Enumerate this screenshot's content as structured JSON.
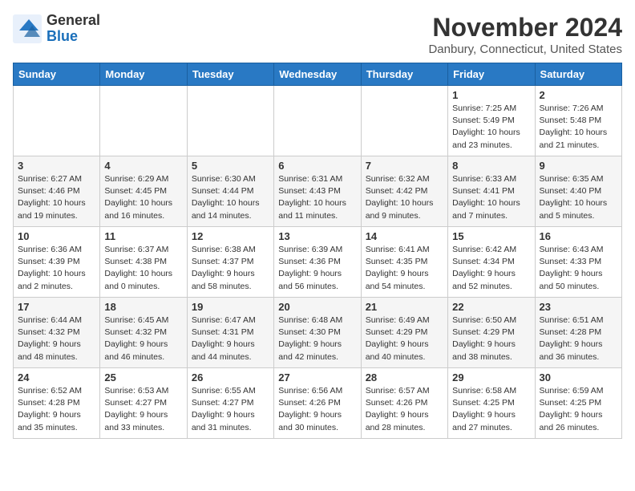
{
  "header": {
    "logo_general": "General",
    "logo_blue": "Blue",
    "month": "November 2024",
    "location": "Danbury, Connecticut, United States"
  },
  "columns": [
    "Sunday",
    "Monday",
    "Tuesday",
    "Wednesday",
    "Thursday",
    "Friday",
    "Saturday"
  ],
  "weeks": [
    [
      {
        "day": "",
        "info": ""
      },
      {
        "day": "",
        "info": ""
      },
      {
        "day": "",
        "info": ""
      },
      {
        "day": "",
        "info": ""
      },
      {
        "day": "",
        "info": ""
      },
      {
        "day": "1",
        "info": "Sunrise: 7:25 AM\nSunset: 5:49 PM\nDaylight: 10 hours\nand 23 minutes."
      },
      {
        "day": "2",
        "info": "Sunrise: 7:26 AM\nSunset: 5:48 PM\nDaylight: 10 hours\nand 21 minutes."
      }
    ],
    [
      {
        "day": "3",
        "info": "Sunrise: 6:27 AM\nSunset: 4:46 PM\nDaylight: 10 hours\nand 19 minutes."
      },
      {
        "day": "4",
        "info": "Sunrise: 6:29 AM\nSunset: 4:45 PM\nDaylight: 10 hours\nand 16 minutes."
      },
      {
        "day": "5",
        "info": "Sunrise: 6:30 AM\nSunset: 4:44 PM\nDaylight: 10 hours\nand 14 minutes."
      },
      {
        "day": "6",
        "info": "Sunrise: 6:31 AM\nSunset: 4:43 PM\nDaylight: 10 hours\nand 11 minutes."
      },
      {
        "day": "7",
        "info": "Sunrise: 6:32 AM\nSunset: 4:42 PM\nDaylight: 10 hours\nand 9 minutes."
      },
      {
        "day": "8",
        "info": "Sunrise: 6:33 AM\nSunset: 4:41 PM\nDaylight: 10 hours\nand 7 minutes."
      },
      {
        "day": "9",
        "info": "Sunrise: 6:35 AM\nSunset: 4:40 PM\nDaylight: 10 hours\nand 5 minutes."
      }
    ],
    [
      {
        "day": "10",
        "info": "Sunrise: 6:36 AM\nSunset: 4:39 PM\nDaylight: 10 hours\nand 2 minutes."
      },
      {
        "day": "11",
        "info": "Sunrise: 6:37 AM\nSunset: 4:38 PM\nDaylight: 10 hours\nand 0 minutes."
      },
      {
        "day": "12",
        "info": "Sunrise: 6:38 AM\nSunset: 4:37 PM\nDaylight: 9 hours\nand 58 minutes."
      },
      {
        "day": "13",
        "info": "Sunrise: 6:39 AM\nSunset: 4:36 PM\nDaylight: 9 hours\nand 56 minutes."
      },
      {
        "day": "14",
        "info": "Sunrise: 6:41 AM\nSunset: 4:35 PM\nDaylight: 9 hours\nand 54 minutes."
      },
      {
        "day": "15",
        "info": "Sunrise: 6:42 AM\nSunset: 4:34 PM\nDaylight: 9 hours\nand 52 minutes."
      },
      {
        "day": "16",
        "info": "Sunrise: 6:43 AM\nSunset: 4:33 PM\nDaylight: 9 hours\nand 50 minutes."
      }
    ],
    [
      {
        "day": "17",
        "info": "Sunrise: 6:44 AM\nSunset: 4:32 PM\nDaylight: 9 hours\nand 48 minutes."
      },
      {
        "day": "18",
        "info": "Sunrise: 6:45 AM\nSunset: 4:32 PM\nDaylight: 9 hours\nand 46 minutes."
      },
      {
        "day": "19",
        "info": "Sunrise: 6:47 AM\nSunset: 4:31 PM\nDaylight: 9 hours\nand 44 minutes."
      },
      {
        "day": "20",
        "info": "Sunrise: 6:48 AM\nSunset: 4:30 PM\nDaylight: 9 hours\nand 42 minutes."
      },
      {
        "day": "21",
        "info": "Sunrise: 6:49 AM\nSunset: 4:29 PM\nDaylight: 9 hours\nand 40 minutes."
      },
      {
        "day": "22",
        "info": "Sunrise: 6:50 AM\nSunset: 4:29 PM\nDaylight: 9 hours\nand 38 minutes."
      },
      {
        "day": "23",
        "info": "Sunrise: 6:51 AM\nSunset: 4:28 PM\nDaylight: 9 hours\nand 36 minutes."
      }
    ],
    [
      {
        "day": "24",
        "info": "Sunrise: 6:52 AM\nSunset: 4:28 PM\nDaylight: 9 hours\nand 35 minutes."
      },
      {
        "day": "25",
        "info": "Sunrise: 6:53 AM\nSunset: 4:27 PM\nDaylight: 9 hours\nand 33 minutes."
      },
      {
        "day": "26",
        "info": "Sunrise: 6:55 AM\nSunset: 4:27 PM\nDaylight: 9 hours\nand 31 minutes."
      },
      {
        "day": "27",
        "info": "Sunrise: 6:56 AM\nSunset: 4:26 PM\nDaylight: 9 hours\nand 30 minutes."
      },
      {
        "day": "28",
        "info": "Sunrise: 6:57 AM\nSunset: 4:26 PM\nDaylight: 9 hours\nand 28 minutes."
      },
      {
        "day": "29",
        "info": "Sunrise: 6:58 AM\nSunset: 4:25 PM\nDaylight: 9 hours\nand 27 minutes."
      },
      {
        "day": "30",
        "info": "Sunrise: 6:59 AM\nSunset: 4:25 PM\nDaylight: 9 hours\nand 26 minutes."
      }
    ]
  ]
}
